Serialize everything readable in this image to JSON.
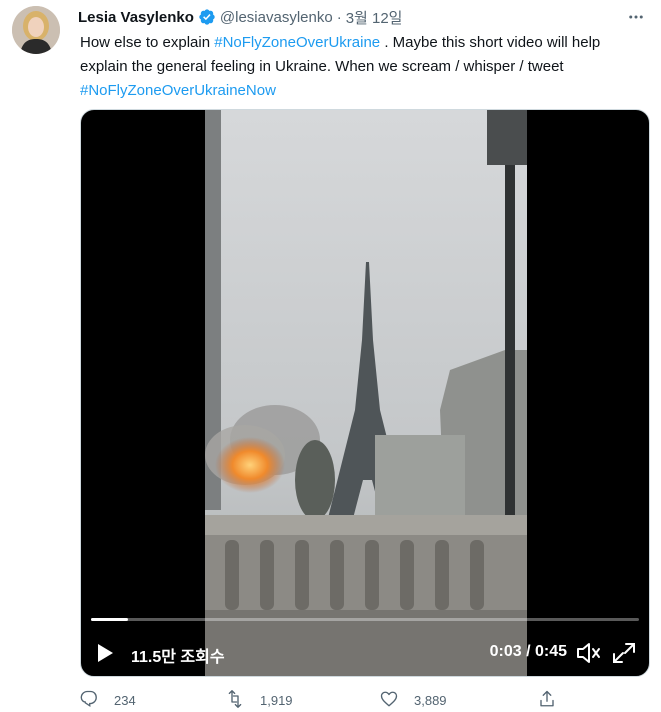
{
  "tweet": {
    "author_name": "Lesia Vasylenko",
    "handle": "@lesiavasylenko",
    "separator": "·",
    "date": "3월 12일",
    "text_part1": "How else to explain ",
    "hashtag1": "#NoFlyZoneOverUkraine",
    "text_part2": " . Maybe this short video will help explain the general feeling in Ukraine. When we scream / whisper / tweet ",
    "hashtag2": "#NoFlyZoneOverUkraineNow"
  },
  "video": {
    "views": "11.5만 조회수",
    "time": "0:03 / 0:45",
    "progress_fraction": 0.0667
  },
  "actions": {
    "reply_count": "234",
    "retweet_count": "1,919",
    "like_count": "3,889"
  },
  "colors": {
    "accent": "#1d9bf0",
    "text": "#0f1419",
    "muted": "#536471"
  },
  "icons": {
    "more": "more-dots-icon",
    "verified": "verified-badge-icon",
    "play": "play-icon",
    "volume": "volume-icon",
    "fullscreen": "fullscreen-icon",
    "reply": "reply-icon",
    "retweet": "retweet-icon",
    "like": "heart-icon",
    "share": "share-icon"
  }
}
